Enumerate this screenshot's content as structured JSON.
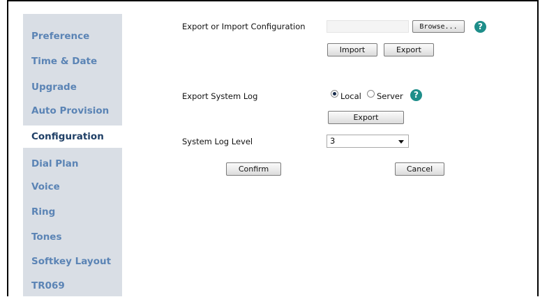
{
  "sidebar": {
    "items": [
      {
        "label": "Preference",
        "active": false
      },
      {
        "label": "Time & Date",
        "active": false
      },
      {
        "label": "Upgrade",
        "active": false
      },
      {
        "label": "Auto Provision",
        "active": false
      },
      {
        "label": "Configuration",
        "active": true
      },
      {
        "label": "Dial Plan",
        "active": false
      },
      {
        "label": "Voice",
        "active": false
      },
      {
        "label": "Ring",
        "active": false
      },
      {
        "label": "Tones",
        "active": false
      },
      {
        "label": "Softkey Layout",
        "active": false
      },
      {
        "label": "TR069",
        "active": false
      }
    ]
  },
  "config": {
    "export_import_label": "Export or Import Configuration",
    "file_value": "",
    "browse_label": "Browse...",
    "import_label": "Import",
    "export_label": "Export"
  },
  "syslog": {
    "export_label": "Export System Log",
    "local_label": "Local",
    "server_label": "Server",
    "selected": "Local",
    "export_button_label": "Export"
  },
  "log_level": {
    "label": "System Log Level",
    "value": "3"
  },
  "actions": {
    "confirm_label": "Confirm",
    "cancel_label": "Cancel"
  },
  "icons": {
    "help": "help-icon",
    "dropdown": "chevron-down-icon"
  },
  "colors": {
    "sidebar_bg": "#d9dee5",
    "nav_text": "#5b84b5",
    "nav_active_text": "#1f3f66",
    "help_icon": "#1e8e8a"
  }
}
